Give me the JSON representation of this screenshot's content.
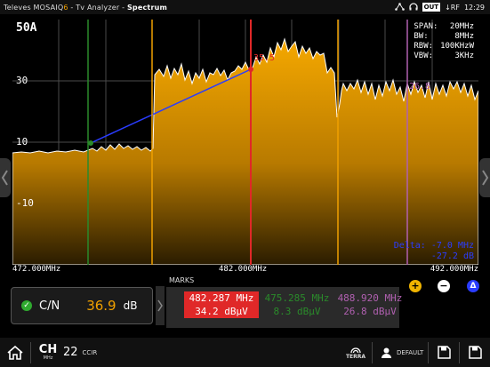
{
  "header": {
    "brand": "Televes MOSAIQ",
    "brand_suffix": "6",
    "separator": " - ",
    "app": "Tv Analyzer",
    "separator2": " - ",
    "view": "Spectrum",
    "status_out": "OUT",
    "status_rf": "↓RF",
    "time": "12:29"
  },
  "spectrum": {
    "ref_level": "50A",
    "y_labels": [
      "30",
      "10",
      "-10"
    ],
    "settings": [
      {
        "key": "SPAN:",
        "value": "20MHz"
      },
      {
        "key": "BW:",
        "value": "8MHz"
      },
      {
        "key": "RBW:",
        "value": "100KHzW"
      },
      {
        "key": "VBW:",
        "value": "3KHz"
      }
    ],
    "peak_red": "35.5",
    "peak_purple": "26.8",
    "delta_label": "Delta: -7.0 MHz",
    "delta_value": "-27.2 dB",
    "freq_start": "472.000MHz",
    "freq_center": "482.000MHz",
    "freq_end": "492.000MHz",
    "colors": {
      "fill": "#f0a000",
      "grid": "#555555",
      "marker_red": "#e02828",
      "marker_green": "#2a8a2a",
      "marker_purple": "#b060b0",
      "marker_orange": "#f0a000",
      "delta_line": "#2a3cff"
    }
  },
  "measurement": {
    "label": "C/N",
    "value": "36.9",
    "unit": "dB",
    "icon": "check-icon"
  },
  "marks": {
    "title": "MARKS",
    "items": [
      {
        "freq": "482.287 MHz",
        "level": "34.2 dBμV",
        "color": "#ffffff"
      },
      {
        "freq": "475.285 MHz",
        "level": "8.3 dBμV",
        "color": "#2a8a2a"
      },
      {
        "freq": "488.920 MHz",
        "level": "26.8 dBμV",
        "color": "#b060b0"
      }
    ],
    "buttons": {
      "add": "+",
      "remove": "−",
      "delta": "Δ"
    }
  },
  "bottom": {
    "channel_label": "CH",
    "channel_sub": "MHz",
    "channel_value": "22",
    "channel_plan": "CCIR",
    "terra_label": "TERRA",
    "profile": "DEFAULT"
  }
}
